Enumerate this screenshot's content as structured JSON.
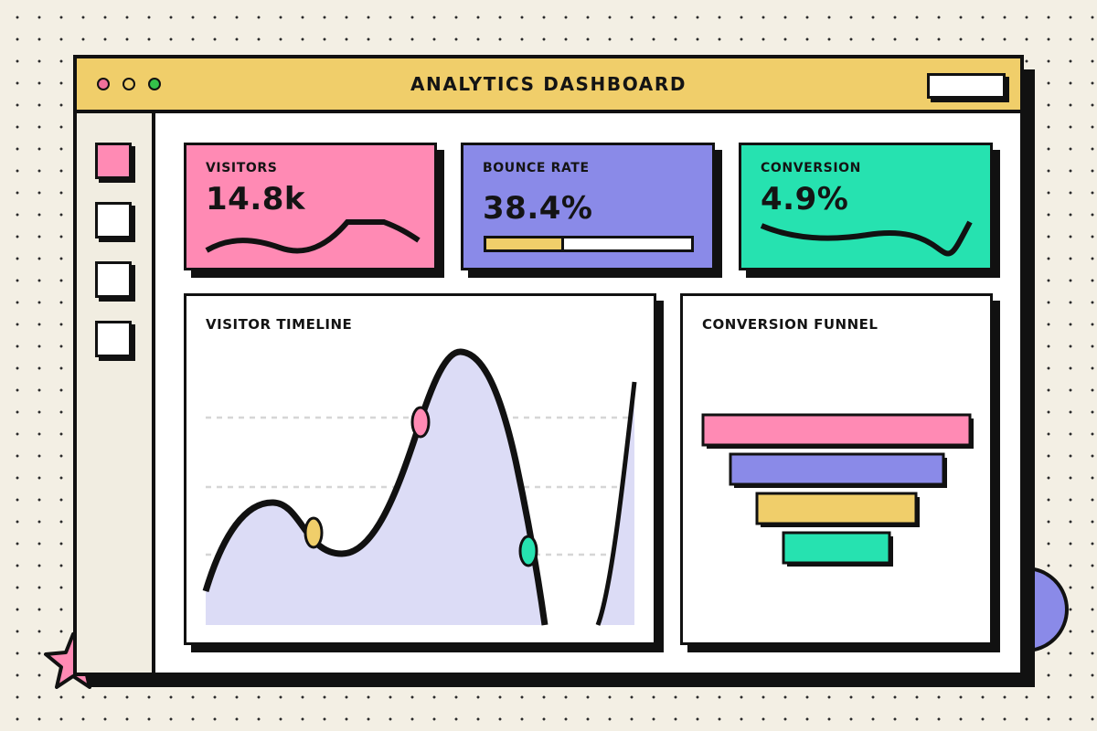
{
  "window": {
    "title": "ANALYTICS DASHBOARD"
  },
  "stats": [
    {
      "label": "VISITORS",
      "value": "14.8k",
      "color": "#ff8ab4"
    },
    {
      "label": "BOUNCE RATE",
      "value": "38.4%",
      "color": "#8a8ae8",
      "progress": 0.38
    },
    {
      "label": "CONVERSION",
      "value": "4.9%",
      "color": "#26e2b0"
    }
  ],
  "timeline": {
    "title": "VISITOR TIMELINE",
    "color": "#dcdcf6"
  },
  "funnel": {
    "title": "CONVERSION FUNNEL",
    "colors": [
      "#ff8ab4",
      "#8a8ae8",
      "#f0ce6a",
      "#26e2b0"
    ]
  },
  "colors": {
    "pink": "#ff8ab4",
    "yellow": "#f0ce6a",
    "purple": "#8a8ae8",
    "teal": "#26e2b0",
    "ink": "#111111"
  },
  "icons": {
    "star": "star-icon",
    "circle": "circle-decoration"
  }
}
